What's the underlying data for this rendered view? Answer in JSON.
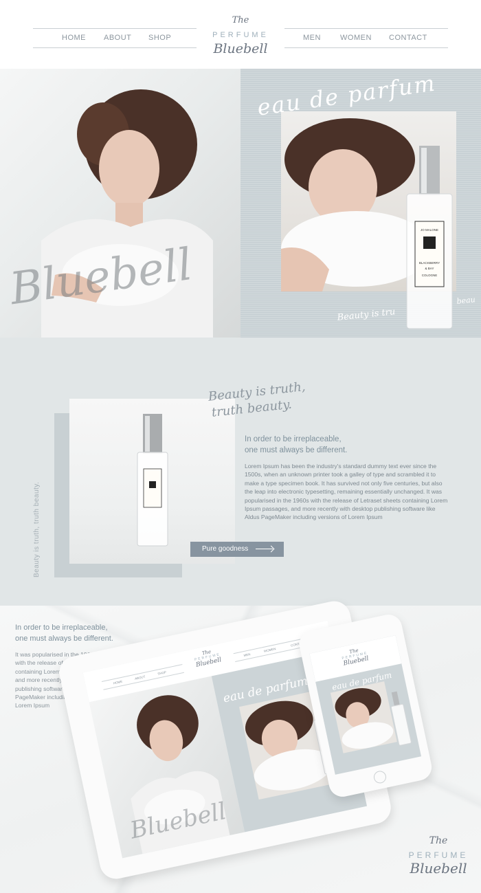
{
  "header": {
    "nav_left": [
      "HOME",
      "ABOUT",
      "SHOP"
    ],
    "nav_right": [
      "MEN",
      "WOMEN",
      "CONTACT"
    ],
    "logo": {
      "the": "The",
      "perfume": "PERFUME",
      "bluebell": "Bluebell"
    }
  },
  "hero": {
    "script_title": "eau de parfum",
    "watermark": "Bluebell",
    "tagline": "Beauty is tru",
    "tagline_2": "beau",
    "bottle_brand": "JO MALONE",
    "bottle_label_1": "BLACKBERRY",
    "bottle_label_2": "& BAY",
    "bottle_label_3": "COLOGNE"
  },
  "intro": {
    "vertical_text": "Beauty is truth, truth beauty.",
    "script_line_1": "Beauty is truth,",
    "script_line_2": "truth beauty.",
    "heading_1": "In order to be irreplaceable,",
    "heading_2": "one must always be different.",
    "body": "Lorem Ipsum has been the industry's standard dummy text ever since the 1500s, when an unknown printer took a galley of type and scrambled it to make a type specimen book. It has survived not only five centuries, but also the leap into electronic typesetting, remaining essentially unchanged. It was popularised in the 1960s with the release of Letraset sheets containing Lorem Ipsum passages, and more recently with desktop publishing software like Aldus PageMaker including versions of Lorem Ipsum",
    "cta_label": "Pure goodness"
  },
  "mockup": {
    "heading_1": "In order to be irreplaceable,",
    "heading_2": "one must always be different.",
    "body": "It was popularised in the 1960s with the release of Letraset sheets containing Lorem Ipsum passages, and more recently with desktop publishing software like Aldus PageMaker including versions of Lorem Ipsum",
    "tablet_nav_left": [
      "HOME",
      "ABOUT",
      "SHOP"
    ],
    "tablet_nav_right": [
      "MEN",
      "WOMEN",
      "CONTACT"
    ],
    "tablet_script": "eau de parfum",
    "tablet_watermark": "Bluebell",
    "phone_script": "eau de parfum"
  },
  "footer_logo": {
    "the": "The",
    "perfume": "PERFUME",
    "bluebell": "Bluebell"
  },
  "colors": {
    "accent": "#8794a0",
    "section_bg": "#e1e6e7",
    "text": "#7d8890"
  }
}
